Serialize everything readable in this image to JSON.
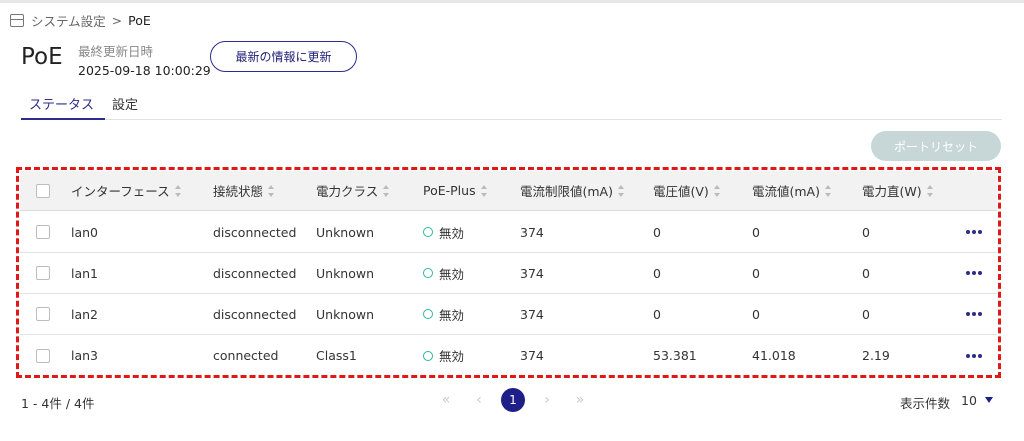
{
  "breadcrumb": {
    "icon": "server-icon",
    "parent": "システム設定",
    "separator": ">",
    "current": "PoE"
  },
  "header": {
    "title": "PoE",
    "last_updated_label": "最終更新日時",
    "last_updated_value": "2025-09-18 10:00:29",
    "refresh_label": "最新の情報に更新"
  },
  "tabs": [
    {
      "label": "ステータス",
      "active": true
    },
    {
      "label": "設定",
      "active": false
    }
  ],
  "actions": {
    "port_reset_label": "ポートリセット",
    "port_reset_disabled": true
  },
  "table": {
    "columns": [
      "インターフェース",
      "接続状態",
      "電力クラス",
      "PoE-Plus",
      "電流制限値(mA)",
      "電圧値(V)",
      "電流値(mA)",
      "電力直(W)"
    ],
    "rows": [
      {
        "interface": "lan0",
        "connection": "disconnected",
        "power_class": "Unknown",
        "poe_plus": "無効",
        "current_limit": "374",
        "voltage": "0",
        "current": "0",
        "power": "0"
      },
      {
        "interface": "lan1",
        "connection": "disconnected",
        "power_class": "Unknown",
        "poe_plus": "無効",
        "current_limit": "374",
        "voltage": "0",
        "current": "0",
        "power": "0"
      },
      {
        "interface": "lan2",
        "connection": "disconnected",
        "power_class": "Unknown",
        "poe_plus": "無効",
        "current_limit": "374",
        "voltage": "0",
        "current": "0",
        "power": "0"
      },
      {
        "interface": "lan3",
        "connection": "connected",
        "power_class": "Class1",
        "poe_plus": "無効",
        "current_limit": "374",
        "voltage": "53.381",
        "current": "41.018",
        "power": "2.19"
      }
    ]
  },
  "footer": {
    "count_text": "1 - 4件 / 4件",
    "pagination": {
      "first": "«",
      "prev": "‹",
      "current_page": "1",
      "next": "›",
      "last": "»"
    },
    "per_page_label": "表示件数",
    "per_page_value": "10"
  },
  "colors": {
    "accent": "#1f1f8a",
    "highlight_border": "#e01818",
    "status_ok": "#2db89a",
    "disabled_button": "#c7d7d8"
  }
}
